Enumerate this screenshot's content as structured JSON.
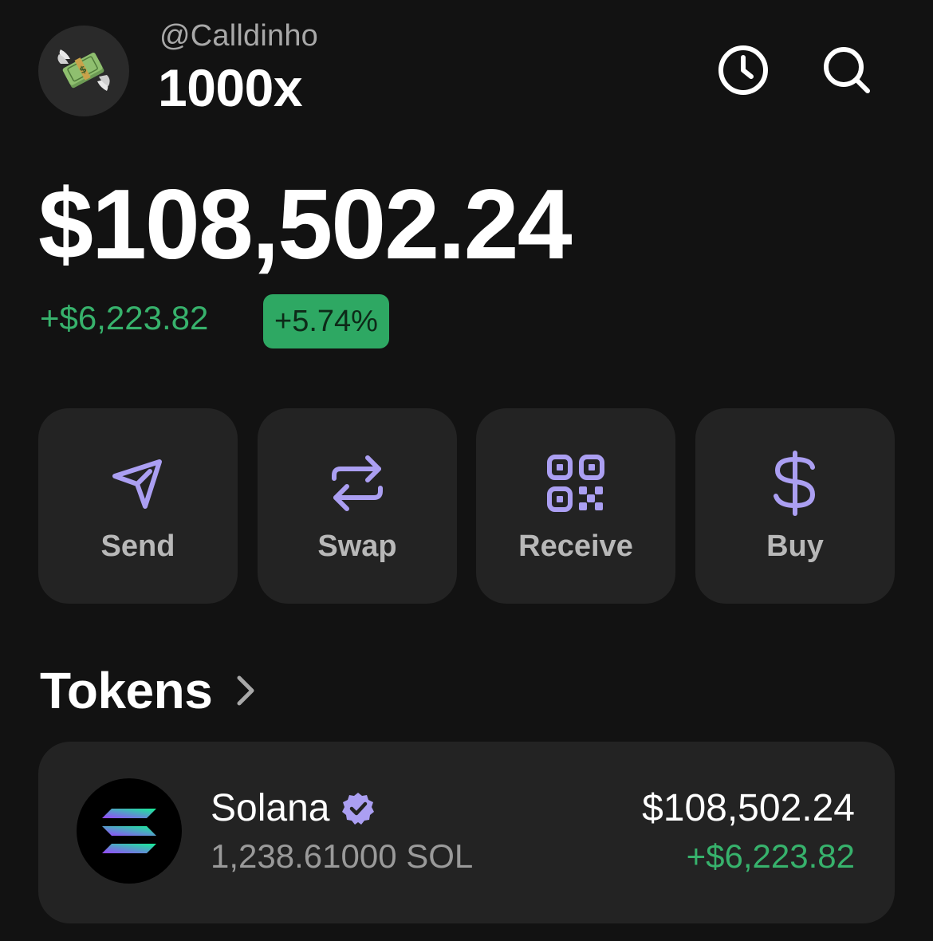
{
  "header": {
    "handle": "@Calldinho",
    "account_name": "1000x",
    "avatar_icon": "money-with-wings-icon",
    "history_icon": "clock-icon",
    "search_icon": "search-icon"
  },
  "portfolio": {
    "balance": "$108,502.24",
    "change_amount": "+$6,223.82",
    "change_percent": "+5.74%"
  },
  "actions": [
    {
      "label": "Send",
      "icon": "send-icon"
    },
    {
      "label": "Swap",
      "icon": "swap-icon"
    },
    {
      "label": "Receive",
      "icon": "qr-code-icon"
    },
    {
      "label": "Buy",
      "icon": "dollar-icon"
    }
  ],
  "tokens": {
    "title": "Tokens",
    "items": [
      {
        "name": "Solana",
        "amount": "1,238.61000 SOL",
        "value": "$108,502.24",
        "change": "+$6,223.82",
        "verified": true
      }
    ]
  },
  "colors": {
    "background": "#121212",
    "card": "#232323",
    "accent_purple": "#ab9ff2",
    "positive_green": "#37b26c",
    "badge_green": "#2ea863"
  }
}
